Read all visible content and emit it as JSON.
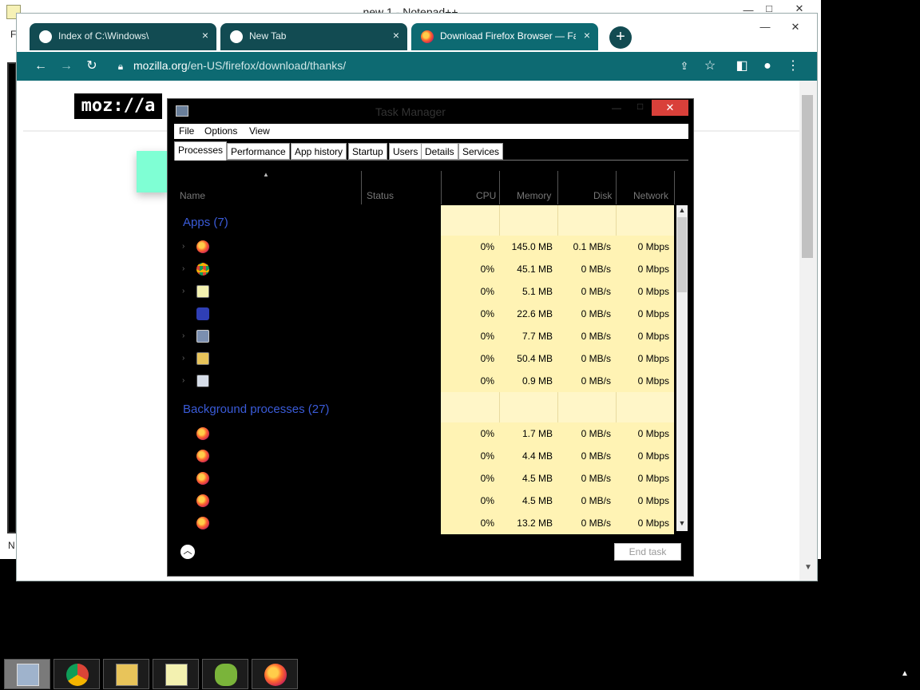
{
  "notepad": {
    "title": "new 1 - Notepad++",
    "menu_letter": "F",
    "status_letter": "N"
  },
  "chrome": {
    "tabs": [
      {
        "label": "Index of C:\\Windows\\",
        "close": "×"
      },
      {
        "label": "New Tab",
        "close": "×"
      },
      {
        "label": "Download Firefox Browser — Fas",
        "close": "×"
      }
    ],
    "new_tab": "+",
    "url": {
      "host": "mozilla.org",
      "path": "/en-US/firefox/download/thanks/"
    },
    "logo": "moz://a"
  },
  "task_manager": {
    "title": "Task Manager",
    "menu": [
      "File",
      "Options",
      "View"
    ],
    "tabs": [
      "Processes",
      "Performance",
      "App history",
      "Startup",
      "Users",
      "Details",
      "Services"
    ],
    "columns": {
      "name": "Name",
      "status": "Status",
      "cpu": "CPU",
      "memory": "Memory",
      "disk": "Disk",
      "network": "Network"
    },
    "groups": {
      "apps": "Apps (7)",
      "background": "Background processes (27)"
    },
    "apps": [
      {
        "icon": "firefox-icon",
        "cpu": "0%",
        "memory": "145.0 MB",
        "disk": "0.1 MB/s",
        "network": "0 Mbps"
      },
      {
        "icon": "chrome-icon",
        "cpu": "0%",
        "memory": "45.1 MB",
        "disk": "0 MB/s",
        "network": "0 Mbps"
      },
      {
        "icon": "notepad-icon",
        "cpu": "0%",
        "memory": "5.1 MB",
        "disk": "0 MB/s",
        "network": "0 Mbps"
      },
      {
        "icon": "settings-gear-icon",
        "cpu": "0%",
        "memory": "22.6 MB",
        "disk": "0 MB/s",
        "network": "0 Mbps"
      },
      {
        "icon": "task-manager-icon",
        "cpu": "0%",
        "memory": "7.7 MB",
        "disk": "0 MB/s",
        "network": "0 Mbps"
      },
      {
        "icon": "file-explorer-icon",
        "cpu": "0%",
        "memory": "50.4 MB",
        "disk": "0 MB/s",
        "network": "0 Mbps"
      },
      {
        "icon": "window-icon",
        "cpu": "0%",
        "memory": "0.9 MB",
        "disk": "0 MB/s",
        "network": "0 Mbps"
      }
    ],
    "background": [
      {
        "icon": "firefox-icon",
        "cpu": "0%",
        "memory": "1.7 MB",
        "disk": "0 MB/s",
        "network": "0 Mbps"
      },
      {
        "icon": "firefox-icon",
        "cpu": "0%",
        "memory": "4.4 MB",
        "disk": "0 MB/s",
        "network": "0 Mbps"
      },
      {
        "icon": "firefox-icon",
        "cpu": "0%",
        "memory": "4.5 MB",
        "disk": "0 MB/s",
        "network": "0 Mbps"
      },
      {
        "icon": "firefox-icon",
        "cpu": "0%",
        "memory": "4.5 MB",
        "disk": "0 MB/s",
        "network": "0 Mbps"
      },
      {
        "icon": "firefox-icon",
        "cpu": "0%",
        "memory": "13.2 MB",
        "disk": "0 MB/s",
        "network": "0 Mbps"
      }
    ],
    "end_task": "End task"
  },
  "taskbar": [
    "task-manager-icon",
    "chrome-icon",
    "file-explorer-icon",
    "notepad-plus-plus-icon",
    "snipping-icon",
    "firefox-icon"
  ]
}
